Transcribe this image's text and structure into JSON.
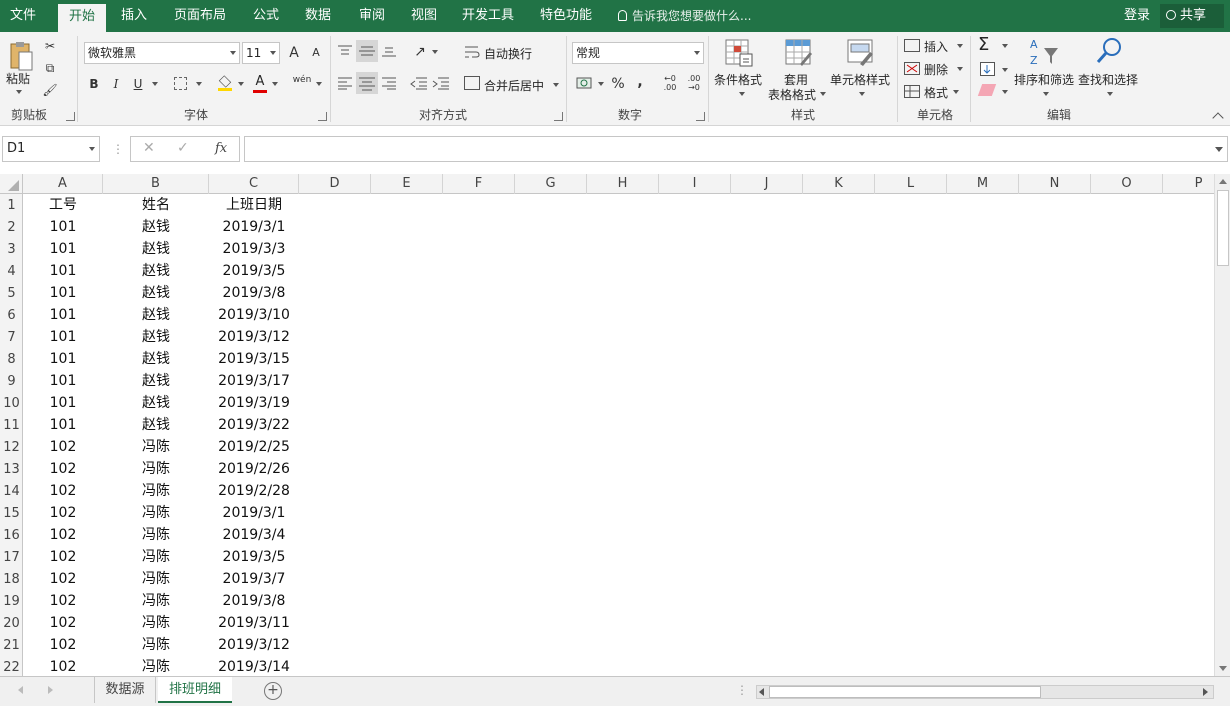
{
  "ribbon_tabs": [
    "文件",
    "开始",
    "插入",
    "页面布局",
    "公式",
    "数据",
    "审阅",
    "视图",
    "开发工具",
    "特色功能"
  ],
  "tell_me": "告诉我您想要做什么...",
  "login": "登录",
  "share": "共享",
  "clipboard": {
    "paste": "粘贴",
    "group": "剪贴板"
  },
  "font": {
    "name": "微软雅黑",
    "size": "11",
    "bold": "B",
    "italic": "I",
    "underline": "U",
    "group": "字体",
    "grow": "A",
    "shrink": "A",
    "color_a": "A",
    "phonetic": "wén"
  },
  "alignment": {
    "wrap": "自动换行",
    "merge": "合并后居中",
    "group": "对齐方式"
  },
  "number": {
    "format": "常规",
    "percent": "%",
    "comma": ",",
    "group": "数字",
    "inc": "←0\n.00",
    "dec": ".00\n→0"
  },
  "styles": {
    "conditional": "条件格式",
    "table1": "套用",
    "table2": "表格格式",
    "cell": "单元格样式",
    "group": "样式"
  },
  "cells_group": {
    "insert": "插入",
    "delete": "删除",
    "format": "格式",
    "group": "单元格"
  },
  "editing": {
    "sum": "Σ",
    "sort": "排序和筛选",
    "find": "查找和选择",
    "group": "编辑"
  },
  "formula_bar": {
    "name_box": "D1",
    "fx": "fx",
    "cancel": "✕",
    "enter": "✓",
    "content": ""
  },
  "columns": [
    "A",
    "B",
    "C",
    "D",
    "E",
    "F",
    "G",
    "H",
    "I",
    "J",
    "K",
    "L",
    "M",
    "N",
    "O",
    "P"
  ],
  "rows": [
    "1",
    "2",
    "3",
    "4",
    "5",
    "6",
    "7",
    "8",
    "9",
    "10",
    "11",
    "12",
    "13",
    "14",
    "15",
    "16",
    "17",
    "18",
    "19",
    "20",
    "21",
    "22"
  ],
  "table": [
    [
      "工号",
      "姓名",
      "上班日期"
    ],
    [
      "101",
      "赵钱",
      "2019/3/1"
    ],
    [
      "101",
      "赵钱",
      "2019/3/3"
    ],
    [
      "101",
      "赵钱",
      "2019/3/5"
    ],
    [
      "101",
      "赵钱",
      "2019/3/8"
    ],
    [
      "101",
      "赵钱",
      "2019/3/10"
    ],
    [
      "101",
      "赵钱",
      "2019/3/12"
    ],
    [
      "101",
      "赵钱",
      "2019/3/15"
    ],
    [
      "101",
      "赵钱",
      "2019/3/17"
    ],
    [
      "101",
      "赵钱",
      "2019/3/19"
    ],
    [
      "101",
      "赵钱",
      "2019/3/22"
    ],
    [
      "102",
      "冯陈",
      "2019/2/25"
    ],
    [
      "102",
      "冯陈",
      "2019/2/26"
    ],
    [
      "102",
      "冯陈",
      "2019/2/28"
    ],
    [
      "102",
      "冯陈",
      "2019/3/1"
    ],
    [
      "102",
      "冯陈",
      "2019/3/4"
    ],
    [
      "102",
      "冯陈",
      "2019/3/5"
    ],
    [
      "102",
      "冯陈",
      "2019/3/7"
    ],
    [
      "102",
      "冯陈",
      "2019/3/8"
    ],
    [
      "102",
      "冯陈",
      "2019/3/11"
    ],
    [
      "102",
      "冯陈",
      "2019/3/12"
    ],
    [
      "102",
      "冯陈",
      "2019/3/14"
    ]
  ],
  "sheets": [
    "数据源",
    "排班明细"
  ],
  "active_sheet": "排班明细",
  "add_sheet": "+",
  "colors": {
    "brand": "#217346",
    "ribbon_bg": "#f3f3f3"
  }
}
